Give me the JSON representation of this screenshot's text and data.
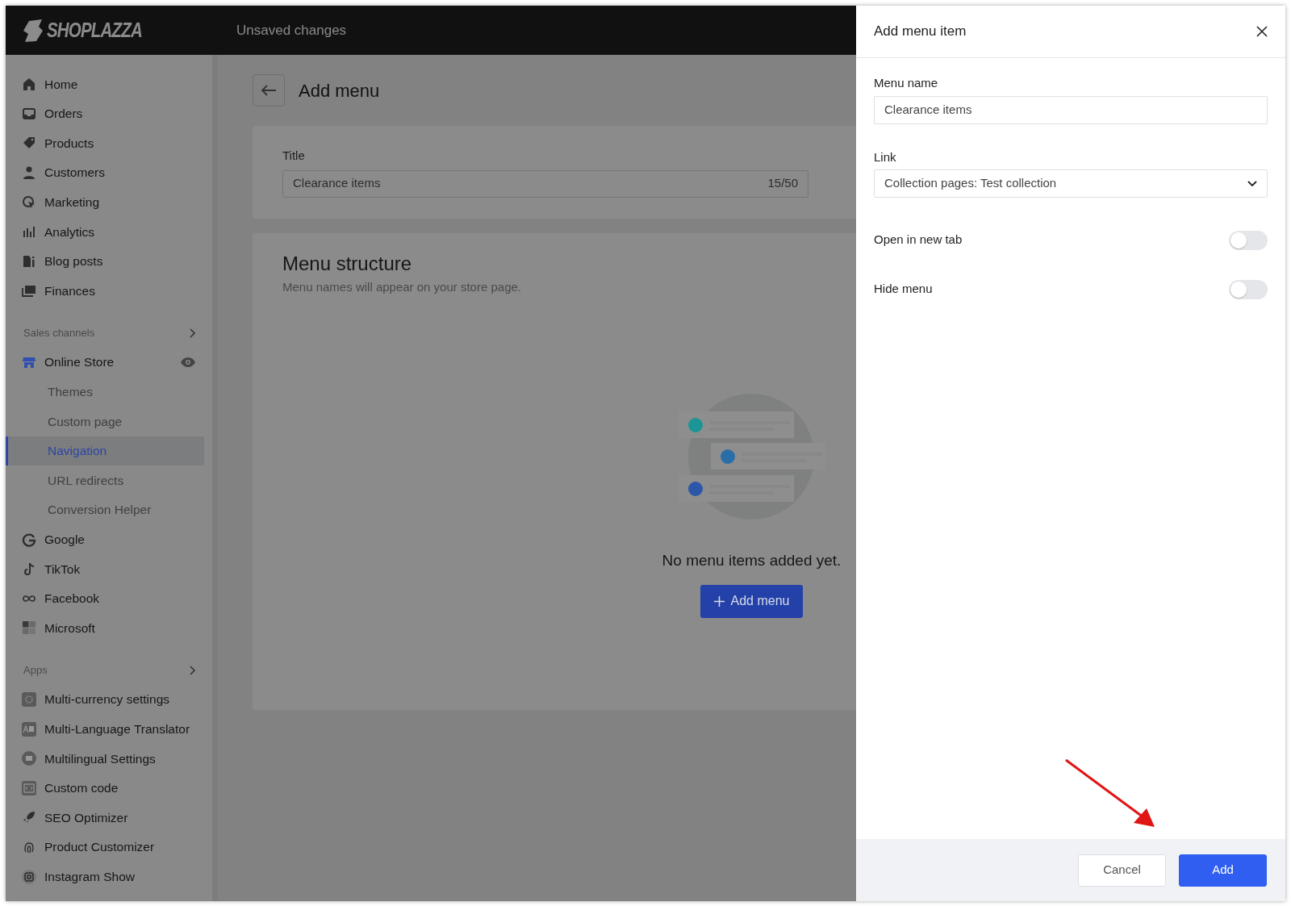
{
  "topbar": {
    "logo": "SHOPLAZZA",
    "status": "Unsaved changes"
  },
  "sidebar": {
    "main_items": [
      {
        "label": "Home",
        "selected": false
      },
      {
        "label": "Orders",
        "selected": false
      },
      {
        "label": "Products",
        "selected": false
      },
      {
        "label": "Customers",
        "selected": false
      },
      {
        "label": "Marketing",
        "selected": false
      },
      {
        "label": "Analytics",
        "selected": false
      },
      {
        "label": "Blog posts",
        "selected": false
      },
      {
        "label": "Finances",
        "selected": false
      }
    ],
    "sales_channels": {
      "heading": "Sales channels",
      "items": [
        {
          "label": "Online Store",
          "selected": false,
          "children": [
            {
              "label": "Themes",
              "selected": false
            },
            {
              "label": "Custom page",
              "selected": false
            },
            {
              "label": "Navigation",
              "selected": true
            },
            {
              "label": "URL redirects",
              "selected": false
            },
            {
              "label": "Conversion Helper",
              "selected": false
            }
          ]
        },
        {
          "label": "Google",
          "selected": false
        },
        {
          "label": "TikTok",
          "selected": false
        },
        {
          "label": "Facebook",
          "selected": false
        },
        {
          "label": "Microsoft",
          "selected": false
        }
      ]
    },
    "apps": {
      "heading": "Apps",
      "items": [
        {
          "label": "Multi-currency settings",
          "selected": false
        },
        {
          "label": "Multi-Language Translator",
          "selected": false
        },
        {
          "label": "Multilingual Settings",
          "selected": false
        },
        {
          "label": "Custom code",
          "selected": false
        },
        {
          "label": "SEO Optimizer",
          "selected": false
        },
        {
          "label": "Product Customizer",
          "selected": false
        },
        {
          "label": "Instagram Show",
          "selected": false
        }
      ]
    }
  },
  "page": {
    "title": "Add menu",
    "title_field": {
      "label": "Title",
      "value": "Clearance items",
      "counter": "15/50"
    },
    "menu_structure": {
      "heading": "Menu structure",
      "subtext": "Menu names will appear on your store page.",
      "empty_text": "No menu items added yet.",
      "button": "Add menu"
    }
  },
  "drawer": {
    "title": "Add menu item",
    "menu_name": {
      "label": "Menu name",
      "value": "Clearance items"
    },
    "link": {
      "label": "Link",
      "value": "Collection pages: Test collection"
    },
    "toggles": [
      {
        "label": "Open in new tab",
        "on": false
      },
      {
        "label": "Hide menu",
        "on": false
      }
    ],
    "buttons": [
      {
        "label": "Cancel",
        "kind": "secondary"
      },
      {
        "label": "Add",
        "kind": "primary"
      }
    ]
  }
}
